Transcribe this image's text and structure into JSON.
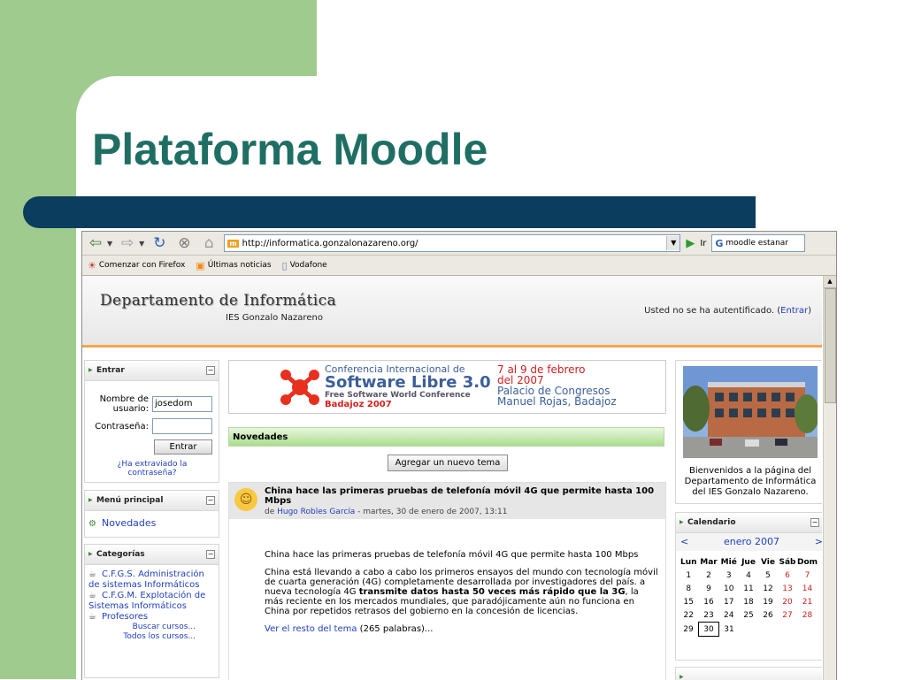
{
  "slide": {
    "title": "Plataforma Moodle"
  },
  "browser": {
    "address_url": "http://informatica.gonzalonazareno.org/",
    "go_label": "Ir",
    "search_value": "moodle estanar",
    "bookmarks": [
      {
        "icon": "firefox-icon",
        "label": "Comenzar con Firefox"
      },
      {
        "icon": "rss-icon",
        "label": "Últimas noticias"
      },
      {
        "icon": "page-icon",
        "label": "Vodafone"
      }
    ]
  },
  "header": {
    "title": "Departamento de Informática",
    "subtitle": "IES Gonzalo Nazareno",
    "login_status": "Usted no se ha autentificado. (",
    "login_link": "Entrar",
    "login_close": ")"
  },
  "login_block": {
    "title": "Entrar",
    "username_label": "Nombre de usuario:",
    "username_value": "josedom",
    "password_label": "Contraseña:",
    "submit_label": "Entrar",
    "forgot_link": "¿Ha extraviado la contraseña?"
  },
  "main_menu": {
    "title": "Menú principal",
    "items": [
      {
        "label": "Novedades"
      }
    ]
  },
  "categories": {
    "title": "Categorías",
    "items": [
      {
        "label": "C.F.G.S. Administración de sistemas Informáticos"
      },
      {
        "label": "C.F.G.M. Explotación de Sistemas Informáticos"
      },
      {
        "label": "Profesores"
      }
    ],
    "search_courses": "Buscar cursos...",
    "all_courses": "Todos los cursos..."
  },
  "banner": {
    "line1": "Conferencia Internacional de",
    "line2": "Software Libre 3.0",
    "line3": "Free Software World Conference",
    "line4": "Badajoz 2007",
    "date1": "7 al 9 de febrero",
    "date2": "del 2007",
    "place1": "Palacio de Congresos",
    "place2": "Manuel Rojas, Badajoz"
  },
  "news": {
    "title": "Novedades",
    "add_button": "Agregar un nuevo tema",
    "post": {
      "subject": "China hace las primeras pruebas de telefonía móvil 4G que permite hasta 100 Mbps",
      "by": "de",
      "author": "Hugo Robles García",
      "date": " - martes, 30 de enero de 2007, 13:11",
      "para1": "China hace las primeras pruebas de telefonía móvil 4G que permite hasta 100 Mbps",
      "para2_a": "China está llevando a cabo a cabo los primeros ensayos del mundo con tecnología móvil de cuarta generación (4G) completamente desarrollada por investigadores del país. a nueva tecnología 4G ",
      "para2_b": "transmite datos hasta 50 veces más rápido que la 3G",
      "para2_c": ", la más reciente en los mercados mundiales, que paradójicamente aún no funciona en China por repetidos retrasos del gobierno en la concesión de licencias.",
      "read_more": "Ver el resto del tema",
      "word_count": " (265 palabras)..."
    }
  },
  "welcome": {
    "text": "Bienvenidos a la página del Departamento de Informática del IES Gonzalo Nazareno."
  },
  "calendar": {
    "title": "Calendario",
    "month": "enero 2007",
    "prev": "<",
    "next": ">",
    "weekdays": [
      "Lun",
      "Mar",
      "Mié",
      "Jue",
      "Vie",
      "Sáb",
      "Dom"
    ],
    "weeks": [
      [
        "1",
        "2",
        "3",
        "4",
        "5",
        "6",
        "7"
      ],
      [
        "8",
        "9",
        "10",
        "11",
        "12",
        "13",
        "14"
      ],
      [
        "15",
        "16",
        "17",
        "18",
        "19",
        "20",
        "21"
      ],
      [
        "22",
        "23",
        "24",
        "25",
        "26",
        "27",
        "28"
      ],
      [
        "29",
        "30",
        "31",
        "",
        "",
        "",
        ""
      ]
    ],
    "today": "30"
  },
  "colors": {
    "slide_green": "#9fcb8e",
    "title_teal": "#1f6e63",
    "bar_navy": "#0b3d5f",
    "accent_orange": "#f3a64a",
    "link_blue": "#1f3fbf",
    "weekend_red": "#d12020"
  }
}
